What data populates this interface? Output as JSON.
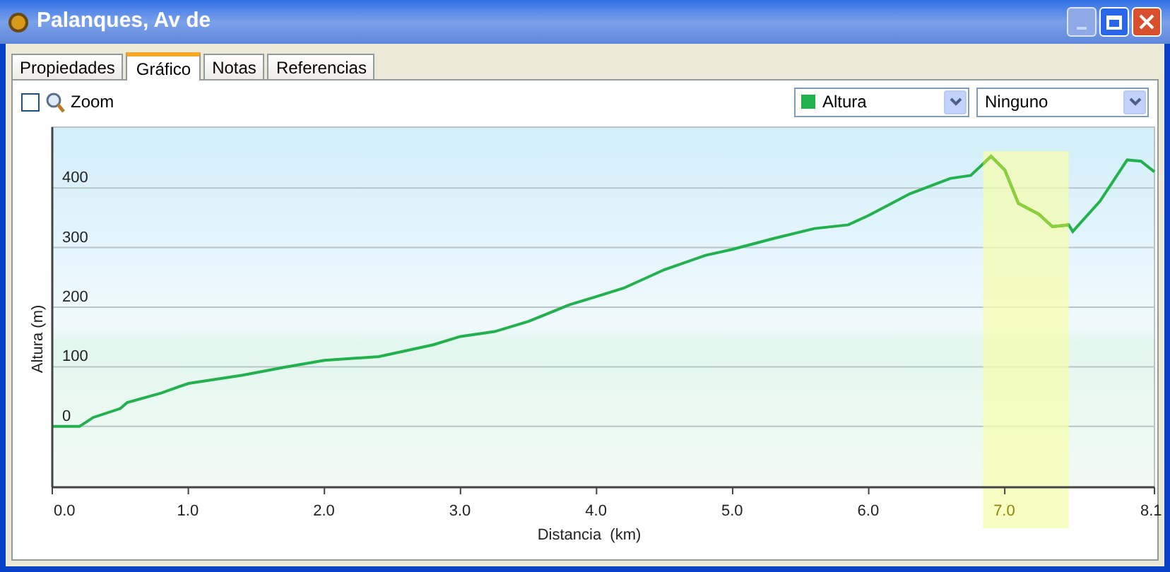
{
  "window": {
    "title": "Palanques, Av de"
  },
  "tabs": [
    {
      "label": "Propiedades",
      "selected": false
    },
    {
      "label": "Gráfico",
      "selected": true
    },
    {
      "label": "Notas",
      "selected": false
    },
    {
      "label": "Referencias",
      "selected": false
    }
  ],
  "toolbar": {
    "zoom": {
      "label": "Zoom",
      "checked": false
    },
    "secondary_select": {
      "value": "Ninguno"
    }
  },
  "chart_data": {
    "type": "line",
    "xlabel": "Distancia  (km)",
    "ylabel": "Altura (m)",
    "x": [
      0,
      0.2,
      0.3,
      0.5,
      0.55,
      0.8,
      1.0,
      1.4,
      1.7,
      2.0,
      2.4,
      2.8,
      3.0,
      3.25,
      3.5,
      3.8,
      4.0,
      4.2,
      4.5,
      4.8,
      5.0,
      5.3,
      5.6,
      5.85,
      6.0,
      6.3,
      6.6,
      6.75,
      6.9,
      7.0,
      7.1,
      7.25,
      7.35,
      7.47,
      7.5,
      7.7,
      7.9,
      8.0,
      8.1
    ],
    "series": [
      {
        "name": "Altura",
        "color": "#22b14c",
        "values": [
          0,
          0,
          15,
          30,
          40,
          56,
          72,
          86,
          99,
          111,
          117,
          137,
          151,
          159,
          176,
          204,
          218,
          232,
          263,
          287,
          297,
          315,
          332,
          338,
          354,
          390,
          416,
          421,
          453,
          430,
          374,
          356,
          335,
          338,
          327,
          378,
          447,
          445,
          427
        ]
      }
    ],
    "xlim": [
      0,
      8.1
    ],
    "ylim": [
      -102,
      502
    ],
    "xticks": [
      {
        "value": 0,
        "label": "0.0"
      },
      {
        "value": 1,
        "label": "1.0"
      },
      {
        "value": 2,
        "label": "2.0"
      },
      {
        "value": 3,
        "label": "3.0"
      },
      {
        "value": 4,
        "label": "4.0"
      },
      {
        "value": 5,
        "label": "5.0"
      },
      {
        "value": 6,
        "label": "6.0"
      },
      {
        "value": 7,
        "label": "7.0"
      },
      {
        "value": 8.1,
        "label": "8.1"
      }
    ],
    "yticks": [
      0,
      100,
      200,
      300,
      400
    ],
    "grid": true,
    "bands": [
      {
        "axis": "x",
        "from": 6.84,
        "to": 7.47
      }
    ]
  }
}
